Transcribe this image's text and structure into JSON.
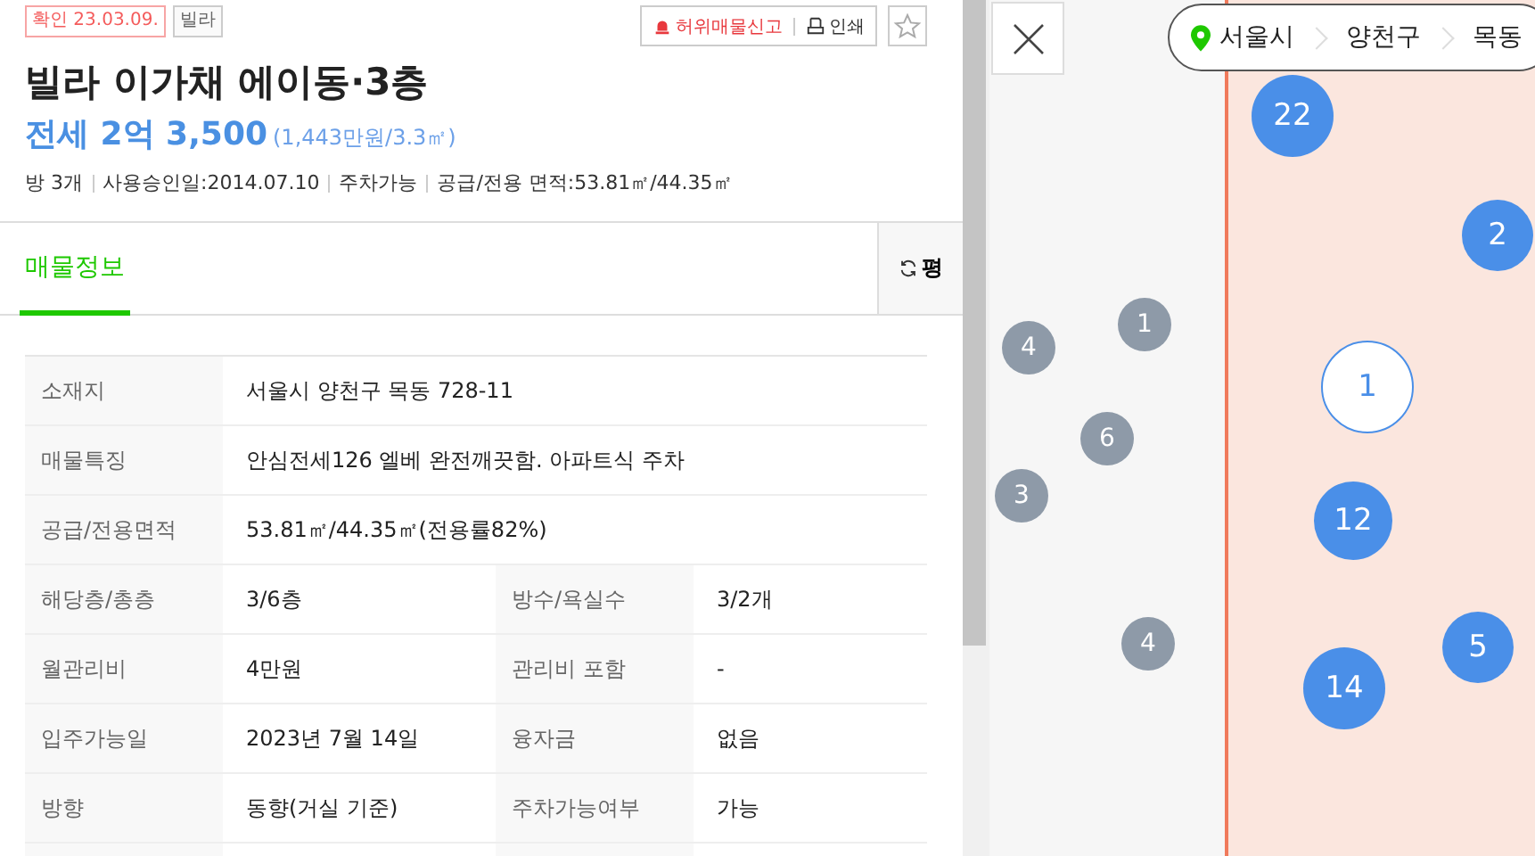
{
  "badges": [
    {
      "text": "확인 23.03.09.",
      "kind": "confirm"
    },
    {
      "text": "빌라",
      "kind": "type"
    }
  ],
  "actions": {
    "report": "허위매물신고",
    "print": "인쇄",
    "favorite": false
  },
  "title": "빌라 이가채 에이동·3층",
  "price": {
    "main": "전세 2억 3,500",
    "unit": "(1,443만원/3.3㎡)"
  },
  "summary": [
    "방 3개",
    "사용승인일:2014.07.10",
    "주차가능",
    "공급/전용 면적:53.81㎡/44.35㎡"
  ],
  "tabs": [
    {
      "label": "매물정보",
      "selected": true
    }
  ],
  "unit_toggle": "평",
  "table": {
    "rows": [
      {
        "cells": [
          {
            "label": "소재지",
            "value": "서울시 양천구 목동 728-11"
          }
        ]
      },
      {
        "cells": [
          {
            "label": "매물특징",
            "value": "안심전세126 엘베 완전깨끗함. 아파트식 주차"
          }
        ]
      },
      {
        "cells": [
          {
            "label": "공급/전용면적",
            "value": "53.81㎡/44.35㎡(전용률82%)"
          }
        ]
      },
      {
        "cells": [
          {
            "label": "해당층/총층",
            "value": "3/6층"
          },
          {
            "label": "방수/욕실수",
            "value": "3/2개"
          }
        ]
      },
      {
        "cells": [
          {
            "label": "월관리비",
            "value": "4만원"
          },
          {
            "label": "관리비 포함",
            "value": "-"
          }
        ]
      },
      {
        "cells": [
          {
            "label": "입주가능일",
            "value": "2023년 7월 14일"
          },
          {
            "label": "융자금",
            "value": "없음"
          }
        ]
      },
      {
        "cells": [
          {
            "label": "방향",
            "value": "동향(거실 기준)"
          },
          {
            "label": "주차가능여부",
            "value": "가능"
          }
        ]
      }
    ]
  },
  "map": {
    "breadcrumb": [
      "서울시",
      "양천구",
      "목동"
    ],
    "clusters": [
      {
        "count": "22",
        "kind": "blue"
      },
      {
        "count": "2",
        "kind": "blue"
      },
      {
        "count": "4",
        "kind": "gray"
      },
      {
        "count": "1",
        "kind": "gray"
      },
      {
        "count": "1",
        "kind": "selected"
      },
      {
        "count": "6",
        "kind": "gray"
      },
      {
        "count": "3",
        "kind": "gray"
      },
      {
        "count": "12",
        "kind": "blue"
      },
      {
        "count": "4",
        "kind": "gray"
      },
      {
        "count": "5",
        "kind": "blue"
      },
      {
        "count": "14",
        "kind": "blue"
      }
    ]
  }
}
